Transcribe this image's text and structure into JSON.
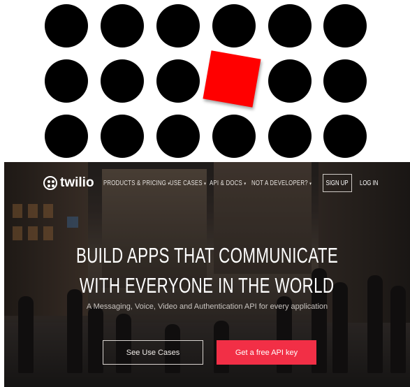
{
  "nav": {
    "logo_text": "twilio",
    "items": [
      {
        "label": "PRODUCTS & PRICING",
        "has_dropdown": true
      },
      {
        "label": "USE CASES",
        "has_dropdown": true
      },
      {
        "label": "API & DOCS",
        "has_dropdown": true
      },
      {
        "label": "NOT A DEVELOPER?",
        "has_dropdown": true
      }
    ],
    "dropdown_glyph": "▾",
    "signup_label": "SIGN UP",
    "login_label": "LOG IN"
  },
  "hero": {
    "title_line1": "BUILD APPS THAT COMMUNICATE",
    "title_line2": "WITH EVERYONE IN THE WORLD",
    "subtitle": "A Messaging, Voice, Video and Authentication API for every application",
    "secondary_button": "See Use Cases",
    "primary_button": "Get a free API key"
  },
  "colors": {
    "brand_red": "#f22f46",
    "graphic_red": "#ff0000",
    "dot_black": "#000000"
  }
}
